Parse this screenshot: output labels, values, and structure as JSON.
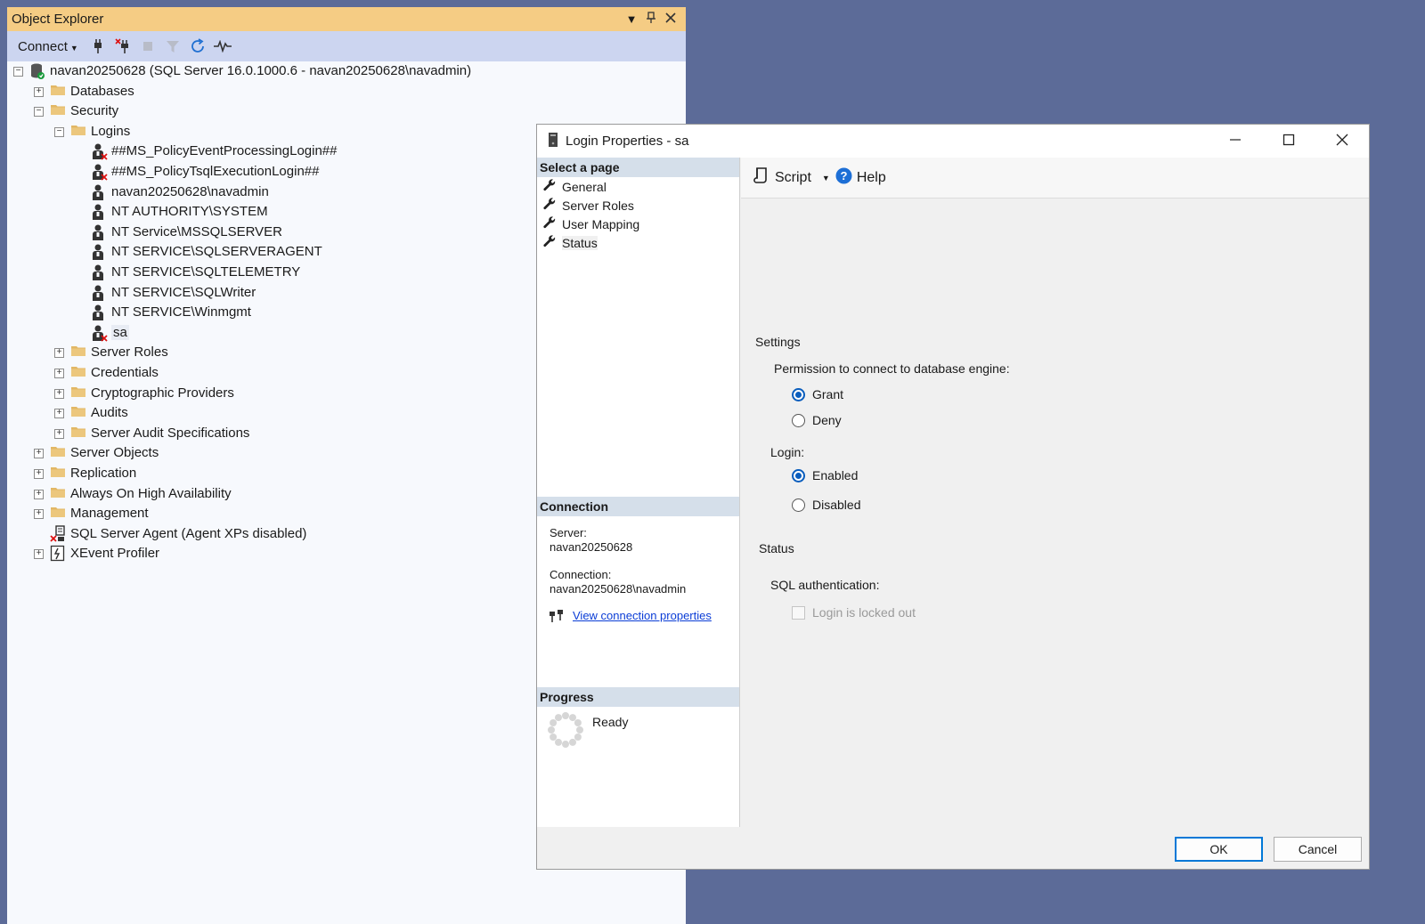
{
  "object_explorer": {
    "title": "Object Explorer",
    "toolbar": {
      "connect_label": "Connect"
    },
    "tree": [
      {
        "label": "navan20250628 (SQL Server 16.0.1000.6 - navan20250628\\navadmin)",
        "level": 0,
        "icon": "server-icon",
        "expander": "minus"
      },
      {
        "label": "Databases",
        "level": 1,
        "icon": "folder-icon",
        "expander": "plus"
      },
      {
        "label": "Security",
        "level": 1,
        "icon": "folder-icon",
        "expander": "minus"
      },
      {
        "label": "Logins",
        "level": 2,
        "icon": "folder-icon",
        "expander": "minus"
      },
      {
        "label": "##MS_PolicyEventProcessingLogin##",
        "level": 3,
        "icon": "login-disabled-icon",
        "expander": ""
      },
      {
        "label": "##MS_PolicyTsqlExecutionLogin##",
        "level": 3,
        "icon": "login-disabled-icon",
        "expander": ""
      },
      {
        "label": "navan20250628\\navadmin",
        "level": 3,
        "icon": "login-icon",
        "expander": ""
      },
      {
        "label": "NT AUTHORITY\\SYSTEM",
        "level": 3,
        "icon": "login-icon",
        "expander": ""
      },
      {
        "label": "NT Service\\MSSQLSERVER",
        "level": 3,
        "icon": "login-icon",
        "expander": ""
      },
      {
        "label": "NT SERVICE\\SQLSERVERAGENT",
        "level": 3,
        "icon": "login-icon",
        "expander": ""
      },
      {
        "label": "NT SERVICE\\SQLTELEMETRY",
        "level": 3,
        "icon": "login-icon",
        "expander": ""
      },
      {
        "label": "NT SERVICE\\SQLWriter",
        "level": 3,
        "icon": "login-icon",
        "expander": ""
      },
      {
        "label": "NT SERVICE\\Winmgmt",
        "level": 3,
        "icon": "login-icon",
        "expander": ""
      },
      {
        "label": "sa",
        "level": 3,
        "icon": "login-disabled-icon",
        "expander": "",
        "selected": true
      },
      {
        "label": "Server Roles",
        "level": 2,
        "icon": "folder-icon",
        "expander": "plus"
      },
      {
        "label": "Credentials",
        "level": 2,
        "icon": "folder-icon",
        "expander": "plus"
      },
      {
        "label": "Cryptographic Providers",
        "level": 2,
        "icon": "folder-icon",
        "expander": "plus"
      },
      {
        "label": "Audits",
        "level": 2,
        "icon": "folder-icon",
        "expander": "plus"
      },
      {
        "label": "Server Audit Specifications",
        "level": 2,
        "icon": "folder-icon",
        "expander": "plus"
      },
      {
        "label": "Server Objects",
        "level": 1,
        "icon": "folder-icon",
        "expander": "plus"
      },
      {
        "label": "Replication",
        "level": 1,
        "icon": "folder-icon",
        "expander": "plus"
      },
      {
        "label": "Always On High Availability",
        "level": 1,
        "icon": "folder-icon",
        "expander": "plus"
      },
      {
        "label": "Management",
        "level": 1,
        "icon": "folder-icon",
        "expander": "plus"
      },
      {
        "label": "SQL Server Agent (Agent XPs disabled)",
        "level": 1,
        "icon": "agent-disabled-icon",
        "expander": ""
      },
      {
        "label": "XEvent Profiler",
        "level": 1,
        "icon": "xevent-icon",
        "expander": "plus"
      }
    ]
  },
  "dialog": {
    "title": "Login Properties - sa",
    "select_page_header": "Select a page",
    "pages": [
      "General",
      "Server Roles",
      "User Mapping",
      "Status"
    ],
    "selected_page": "Status",
    "toolbar": {
      "script_label": "Script",
      "help_label": "Help"
    },
    "connection": {
      "header": "Connection",
      "server_label": "Server:",
      "server_value": "navan20250628",
      "connection_label": "Connection:",
      "connection_value": "navan20250628\\navadmin",
      "link_label": "View connection properties"
    },
    "progress": {
      "header": "Progress",
      "status": "Ready"
    },
    "settings": {
      "header": "Settings",
      "permission_label": "Permission to connect to database engine:",
      "grant_label": "Grant",
      "deny_label": "Deny",
      "permission_value": "Grant",
      "login_label": "Login:",
      "enabled_label": "Enabled",
      "disabled_label": "Disabled",
      "login_value": "Enabled"
    },
    "status": {
      "header": "Status",
      "sql_auth_label": "SQL authentication:",
      "locked_out_label": "Login is locked out",
      "locked_out_checked": false
    },
    "buttons": {
      "ok": "OK",
      "cancel": "Cancel"
    }
  },
  "colors": {
    "desktop": "#5c6b98",
    "oe_title_bar": "#f5cc84",
    "oe_toolbar": "#ccd5f0",
    "accent": "#0a5dbd",
    "link": "#0a3cd6"
  }
}
